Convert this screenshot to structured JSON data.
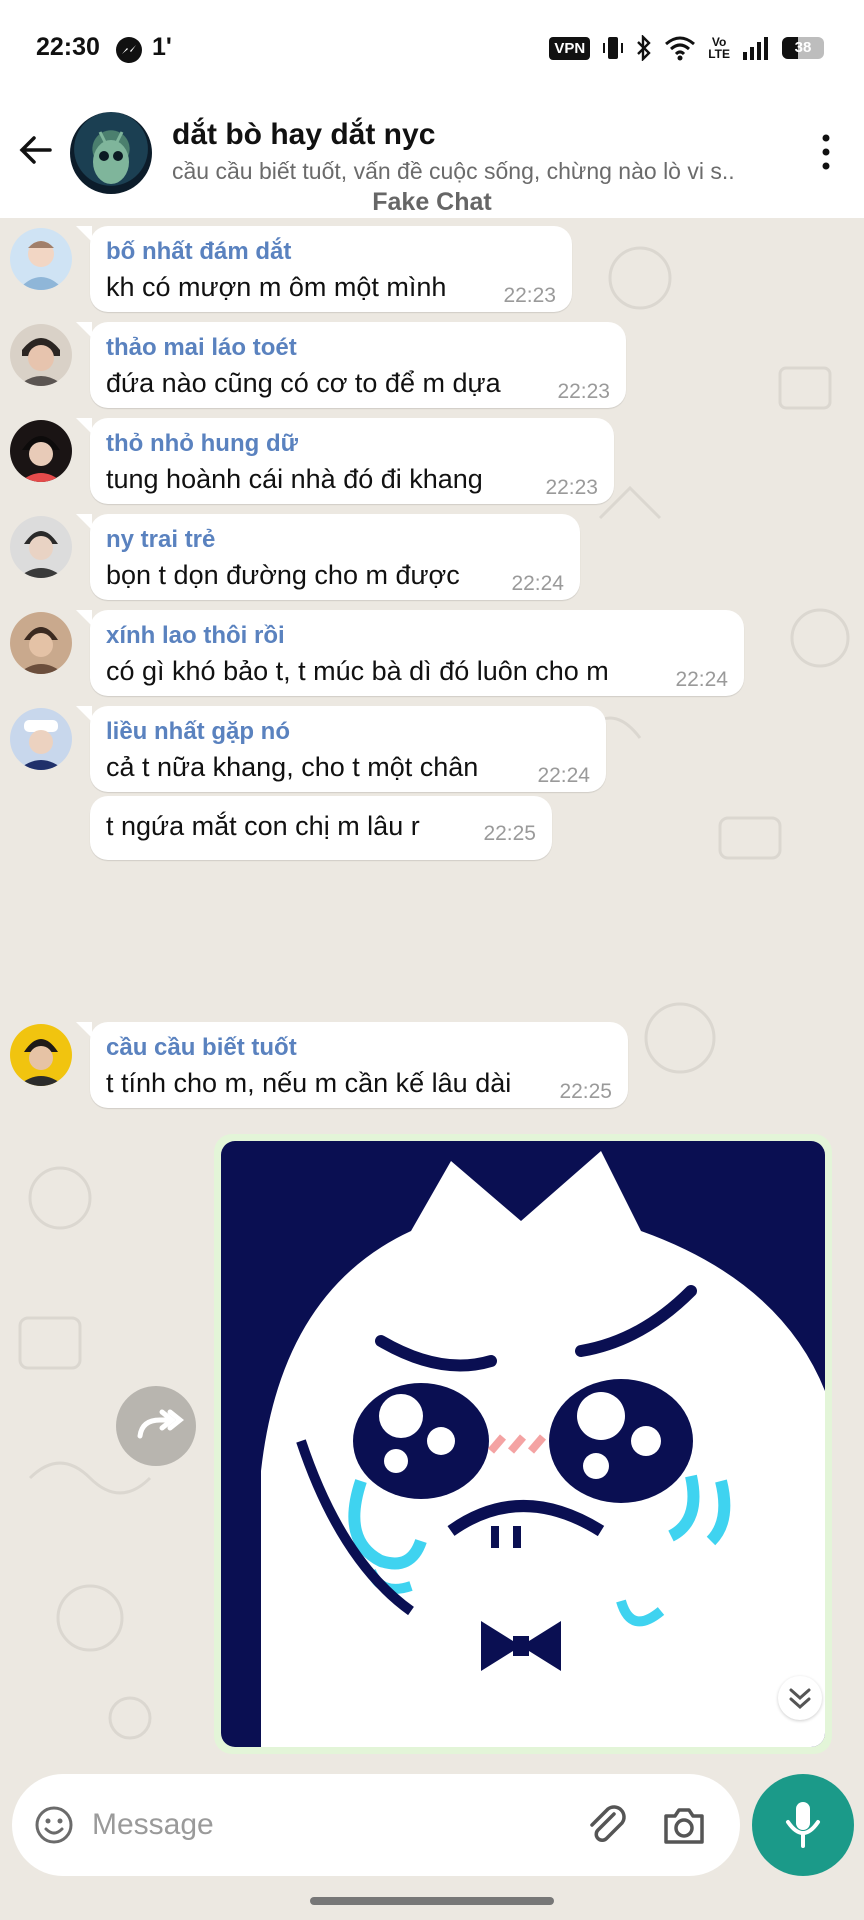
{
  "status_bar": {
    "time": "22:30",
    "notification_count": "1'",
    "vpn_label": "VPN",
    "volte_label": "Vo LTE",
    "battery": "38",
    "icons": [
      "messenger-icon",
      "vibrate-icon",
      "bluetooth-icon",
      "wifi-icon",
      "signal-icon",
      "battery-icon"
    ]
  },
  "header": {
    "title": "dắt bò hay dắt nyc",
    "subtitle": "cầu cầu biết tuốt, vấn đề cuộc sống, chừng nào lò vi s..",
    "label": "Fake Chat"
  },
  "messages": [
    {
      "sender": "bố nhất đám dắt",
      "text": "kh có mượn m ôm một mình",
      "time": "22:23"
    },
    {
      "sender": "thảo mai láo toét",
      "text": "đứa nào cũng có cơ to để m dựa",
      "time": "22:23"
    },
    {
      "sender": "thỏ nhỏ hung dữ",
      "text": "tung hoành cái nhà đó đi khang",
      "time": "22:23"
    },
    {
      "sender": "ny trai trẻ",
      "text": "bọn t dọn đường cho m được",
      "time": "22:24"
    },
    {
      "sender": "xính lao thôi rồi",
      "text": "có gì khó bảo t, t múc bà dì đó luôn cho m",
      "time": "22:24"
    },
    {
      "sender": "liều nhất gặp nó",
      "text": "cả t nữa khang, cho t một chân",
      "time": "22:24"
    },
    {
      "sender": "",
      "text": "t ngứa mắt con chị m lâu r",
      "time": "22:25"
    },
    {
      "sender": "cầu cầu biết tuốt",
      "text": "t tính cho m, nếu m cần kế lâu dài",
      "time": "22:25"
    }
  ],
  "composer": {
    "placeholder": "Message"
  },
  "colors": {
    "sender_name": "#5a82bf",
    "accent": "#1b9a89",
    "chat_background": "#ece8e1",
    "outgoing_bubble": "#e3f5d8",
    "sticker_navy": "#0a0f52",
    "sticker_tear": "#3fd3f0"
  }
}
